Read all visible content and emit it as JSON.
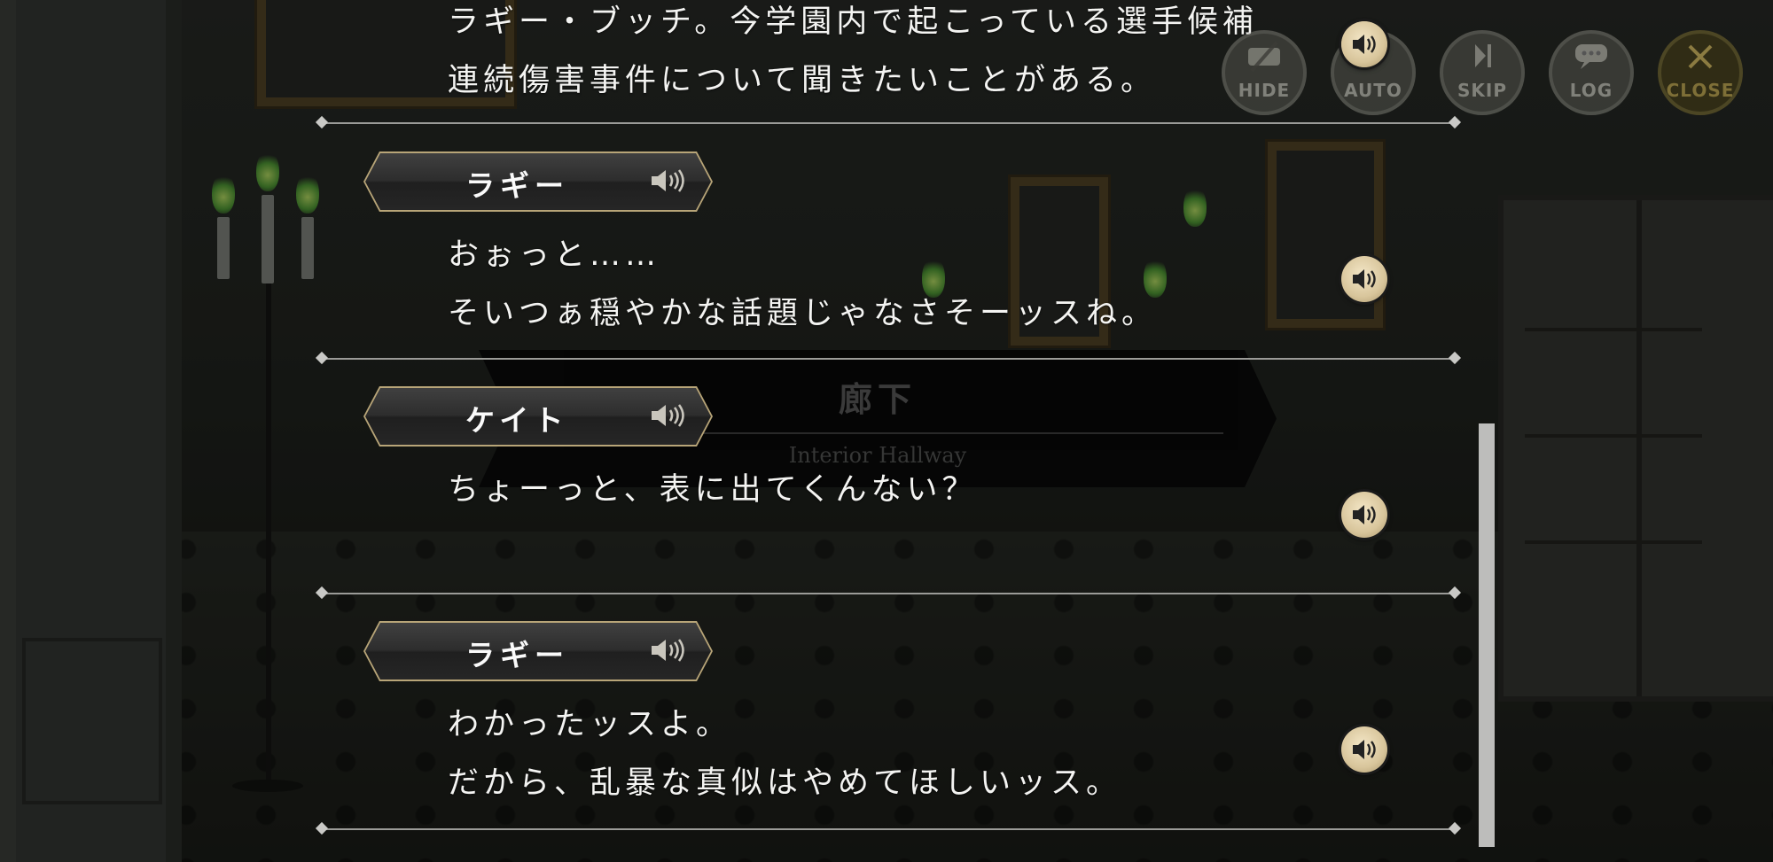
{
  "location": {
    "name_jp": "廊下",
    "name_en": "Interior Hallway"
  },
  "controls": {
    "hide": "HIDE",
    "auto": "AUTO",
    "skip": "SKIP",
    "log": "LOG",
    "close": "CLOSE"
  },
  "log": {
    "entry0": {
      "line1": "ラギー・ブッチ。今学園内で起こっている選手候補",
      "line2": "連続傷害事件について聞きたいことがある。"
    },
    "entry1": {
      "speaker": "ラギー",
      "line1": "おぉっと……",
      "line2": "そいつぁ穏やかな話題じゃなさそーッスね。"
    },
    "entry2": {
      "speaker": "ケイト",
      "line1": "ちょーっと、表に出てくんない？"
    },
    "entry3": {
      "speaker": "ラギー",
      "line1": "わかったッスよ。",
      "line2": "だから、乱暴な真似はやめてほしいッス。"
    }
  },
  "colors": {
    "nameplate_border": "#b8a578",
    "voice_button": "#d8c59b",
    "text": "#f4f4f2",
    "flame": "#7ed04a"
  },
  "icons": {
    "voice": "speaker-icon",
    "hide": "eye-slash-icon",
    "skip": "skip-icon",
    "log": "chat-bubble-icon",
    "close": "x-icon"
  }
}
